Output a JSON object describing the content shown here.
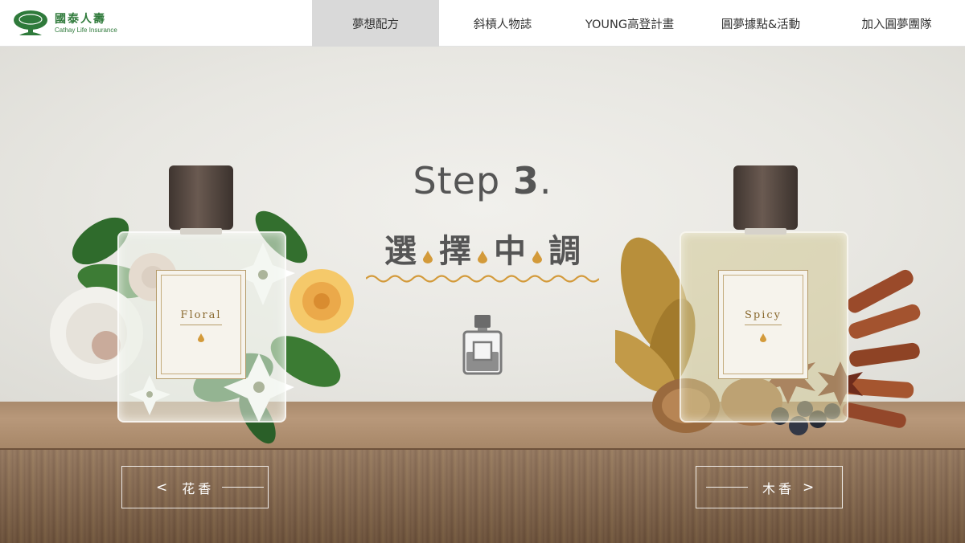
{
  "header": {
    "logo": {
      "name_zh": "國泰人壽",
      "name_en": "Cathay Life Insurance"
    },
    "nav": [
      {
        "label": "夢想配方",
        "active": true
      },
      {
        "label": "斜槓人物誌",
        "active": false
      },
      {
        "label": "YOUNG高登計畫",
        "active": false
      },
      {
        "label": "圓夢據點&活動",
        "active": false
      },
      {
        "label": "加入圓夢團隊",
        "active": false
      }
    ]
  },
  "main": {
    "step_word": "Step",
    "step_number": "3",
    "step_dot": ".",
    "heading_chars": [
      "選",
      "擇",
      "中",
      "調"
    ]
  },
  "perfumes": {
    "left": {
      "label": "Floral",
      "button_label": "花香",
      "arrow": "<"
    },
    "right": {
      "label": "Spicy",
      "button_label": "木香",
      "arrow": ">"
    }
  },
  "colors": {
    "brand_green": "#2f7a3b",
    "accent_gold": "#d39a3a",
    "text_gray": "#555555",
    "nav_active_bg": "#d9d9d9"
  },
  "icons": [
    "cathay-tree-logo-icon",
    "drop-icon",
    "wave-divider-icon",
    "perfume-bottle-icon"
  ]
}
